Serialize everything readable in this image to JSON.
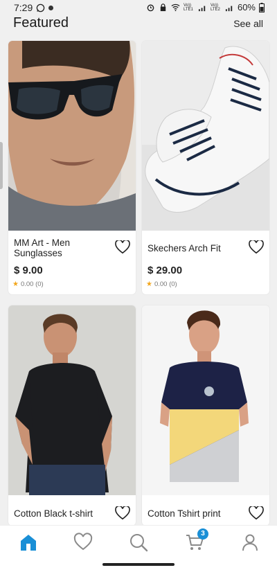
{
  "status": {
    "time": "7:29",
    "net1": "Vo)) LTE1",
    "net2": "Vo)) LTE2",
    "battery": "60%"
  },
  "header": {
    "title": "Featured",
    "see_all": "See all"
  },
  "products": [
    {
      "name": "MM Art - Men Sunglasses",
      "price": "$ 9.00",
      "rating": "0.00 (0)"
    },
    {
      "name": "Skechers Arch Fit",
      "price": "$ 29.00",
      "rating": "0.00 (0)"
    },
    {
      "name": "Cotton Black t-shirt"
    },
    {
      "name": "Cotton Tshirt print"
    }
  ],
  "nav": {
    "items": [
      "home-icon",
      "heart-icon",
      "search-icon",
      "cart-icon",
      "person-icon"
    ],
    "cart_count": "3",
    "active_color": "#1a8fd6"
  },
  "colors": {
    "accent": "#1a8fd6",
    "star": "#f2a51a"
  }
}
